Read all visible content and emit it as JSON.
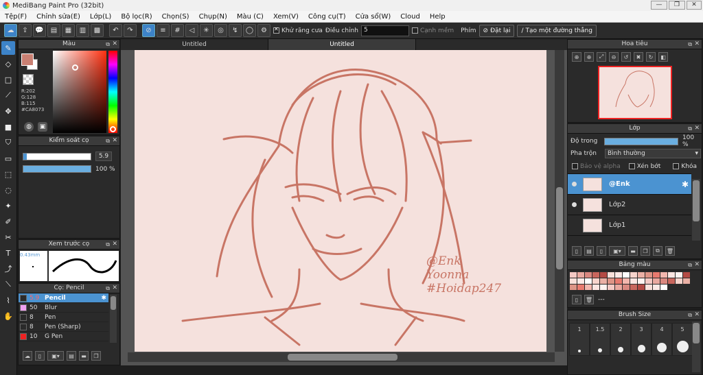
{
  "window": {
    "title": "MediBang Paint Pro (32bit)",
    "min": "—",
    "max": "❐",
    "close": "✕"
  },
  "menu": [
    "Tệp(F)",
    "Chỉnh sửa(E)",
    "Lớp(L)",
    "Bộ lọc(R)",
    "Chọn(S)",
    "Chụp(N)",
    "Màu (C)",
    "Xem(V)",
    "Công cụ(T)",
    "Cửa sổ(W)",
    "Cloud",
    "Help"
  ],
  "toolbar": {
    "antialias_label": "Khử răng cưa",
    "adjust_label": "Điều chỉnh",
    "adjust_value": "5",
    "edge_label": "Cạnh mềm",
    "key_label": "Phím",
    "reset_label": "Đặt lại",
    "line_label": "Tạo một đường thẳng"
  },
  "tabs": [
    "Untitled",
    "Untitled"
  ],
  "color_panel": {
    "title": "Màu",
    "primary_color": "#CA8073",
    "r": "R:202",
    "g": "G:128",
    "b": "B:115",
    "hex": "#CA8073"
  },
  "brush_control": {
    "title": "Kiểm soát cọ",
    "size": "5.9",
    "opacity": "100 %",
    "size_fraction": 0.05,
    "opacity_fraction": 1.0
  },
  "brush_preview": {
    "title": "Xem trước cọ",
    "size_label": "0.43mm"
  },
  "brush_list": {
    "title": "Cọ: Pencil",
    "items": [
      {
        "size": "5.9",
        "name": "Pencil",
        "color": "#2a2a2a"
      },
      {
        "size": "50",
        "name": "Blur",
        "color": "#f0a0f0"
      },
      {
        "size": "8",
        "name": "Pen",
        "color": "#2a2a2a"
      },
      {
        "size": "8",
        "name": "Pen (Sharp)",
        "color": "#2a2a2a"
      },
      {
        "size": "10",
        "name": "G Pen",
        "color": "#e22"
      }
    ]
  },
  "navigator": {
    "title": "Hoa tiêu"
  },
  "layers": {
    "title": "Lớp",
    "opacity_label": "Độ trong",
    "opacity_value": "100 %",
    "blend_label": "Pha trộn",
    "blend_value": "Bình thường",
    "protect_alpha": "Bảo vệ alpha",
    "clipping": "Xén bớt",
    "lock": "Khóa",
    "items": [
      {
        "name": "@Enk"
      },
      {
        "name": "Lớp2"
      },
      {
        "name": "Lớp1"
      }
    ]
  },
  "palette": {
    "title": "Bảng màu",
    "footer": "---"
  },
  "brush_size": {
    "title": "Brush Size",
    "sizes": [
      "1",
      "1.5",
      "2",
      "3",
      "4",
      "5"
    ]
  },
  "canvas_text": {
    "line1": "@Enk",
    "line2": "Yoonna",
    "line3": "#Hoidap247"
  }
}
